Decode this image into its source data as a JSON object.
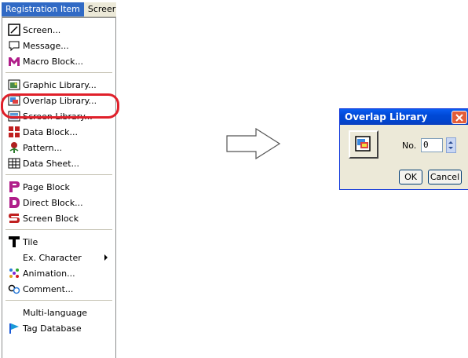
{
  "menubar": {
    "items": [
      "Registration Item",
      "Screer"
    ]
  },
  "menu": {
    "items": [
      {
        "label": "Screen...",
        "icon": "screen-icon"
      },
      {
        "label": "Message...",
        "icon": "message-icon"
      },
      {
        "label": "Macro Block...",
        "icon": "macro-block-icon"
      },
      {
        "label": "Graphic Library...",
        "icon": "graphic-library-icon"
      },
      {
        "label": "Overlap Library...",
        "icon": "overlap-library-icon"
      },
      {
        "label": "Screen Library...",
        "icon": "screen-library-icon"
      },
      {
        "label": "Data Block...",
        "icon": "data-block-icon"
      },
      {
        "label": "Pattern...",
        "icon": "pattern-icon"
      },
      {
        "label": "Data Sheet...",
        "icon": "data-sheet-icon"
      },
      {
        "label": "Page Block",
        "icon": "page-block-icon"
      },
      {
        "label": "Direct Block...",
        "icon": "direct-block-icon"
      },
      {
        "label": "Screen Block",
        "icon": "screen-block-icon"
      },
      {
        "label": "Tile",
        "icon": "tile-icon"
      },
      {
        "label": "Ex. Character",
        "icon": "none"
      },
      {
        "label": "Animation...",
        "icon": "animation-icon"
      },
      {
        "label": "Comment...",
        "icon": "comment-icon"
      },
      {
        "label": "Multi-language",
        "icon": "none"
      },
      {
        "label": "Tag Database",
        "icon": "tag-database-icon"
      }
    ]
  },
  "dialog": {
    "title": "Overlap Library",
    "no_label": "No.",
    "no_value": "0",
    "ok_label": "OK",
    "cancel_label": "Cancel"
  },
  "colors": {
    "highlight": "#e0202a",
    "menu_selected": "#316ac5",
    "title_bar": "#0049d6"
  }
}
